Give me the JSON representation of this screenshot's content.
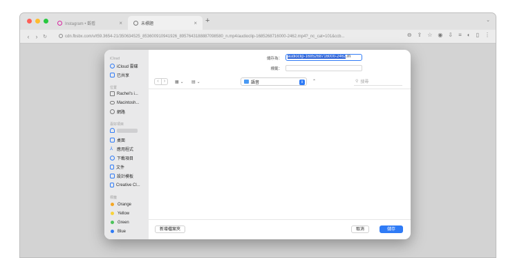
{
  "browser": {
    "tabs": [
      {
        "label": "Instagram • 觀看",
        "active": false
      },
      {
        "label": "未標題",
        "active": true
      }
    ],
    "url": "cdn.fbsbx.com/v/t59.3654-21/350634525_853600910941926_8957643188887098580_n.mp4/audioclip-1685268716000-2462.mp4?_nc_cat=101&ccb..."
  },
  "dialog": {
    "save_as_label": "儲存為：",
    "filename_selected": "audioclip-1685268716000-2462",
    "filename_rest": ".m",
    "tags_label": "標籤：",
    "location": "語音",
    "search_placeholder": "搜尋",
    "new_folder_button": "新增檔案夾",
    "cancel_button": "取消",
    "save_button": "儲存"
  },
  "sidebar": {
    "icloud_header": "iCloud",
    "icloud_items": [
      "iCloud 雲碟",
      "已共享"
    ],
    "locations_header": "位置",
    "location_items": [
      "Rachel's i...",
      "Macintosh...",
      "網路"
    ],
    "favorites_header": "喜好項目",
    "favorite_items": [
      "桌面",
      "應用程式",
      "下載項目",
      "文件",
      "設計模板",
      "Creative Cl..."
    ],
    "tags_header": "標籤",
    "tags": [
      {
        "label": "Orange",
        "color": "#f5a623"
      },
      {
        "label": "Yellow",
        "color": "#f8d33a"
      },
      {
        "label": "Green",
        "color": "#4cc35a"
      },
      {
        "label": "Blue",
        "color": "#2f7bf6"
      }
    ]
  },
  "colors": {
    "accent": "#2f7bf6",
    "traffic_red": "#fe5f57",
    "traffic_yellow": "#febc2e",
    "traffic_green": "#28c840"
  }
}
